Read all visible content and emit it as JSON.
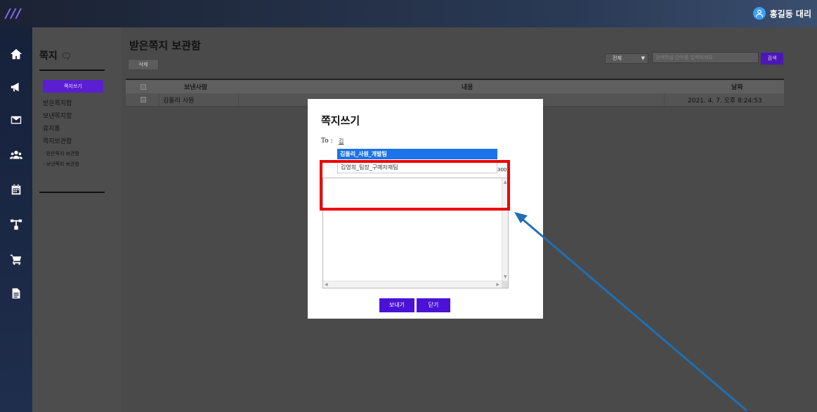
{
  "topbar": {
    "logo": "///",
    "user_name": "홍길동 대리"
  },
  "rail": {
    "icons": [
      "home-icon",
      "megaphone-icon",
      "mail-icon",
      "users-icon",
      "calendar-icon",
      "org-chart-icon",
      "cart-icon",
      "document-icon"
    ]
  },
  "sidebar": {
    "title": "쪽지",
    "title_icon": "chat-bubble-icon",
    "compose_label": "쪽지쓰기",
    "items": [
      {
        "label": "받은쪽지함"
      },
      {
        "label": "보낸쪽지함"
      },
      {
        "label": "휴지통"
      },
      {
        "label": "쪽지보관함"
      }
    ],
    "sub_items": [
      {
        "label": "- 받은쪽지 보관함"
      },
      {
        "label": "- 보낸쪽지 보관함"
      }
    ]
  },
  "main": {
    "title": "받은쪽지 보관함",
    "delete_label": "삭제",
    "filter": {
      "selected": "전체"
    },
    "search": {
      "placeholder": "검색하실 단어를 입력하세요",
      "button": "검색"
    },
    "table": {
      "headers": {
        "sender": "보낸사람",
        "content": "내용",
        "date": "날짜"
      },
      "rows": [
        {
          "sender": "김둘리 사원",
          "content": "",
          "date": "2021. 4. 7. 오후 8:24:53"
        }
      ]
    }
  },
  "modal": {
    "title": "쪽지쓰기",
    "to_label": "To :",
    "to_value": "김",
    "suggestions": [
      "김둘리_사원_개발팀",
      "김영희_팀장_구매자재팀"
    ],
    "counter": "300",
    "send_label": "보내기",
    "close_label": "닫기"
  },
  "colors": {
    "accent": "#4a12d6",
    "highlight": "#1a73e8",
    "annotation_box": "#ee0000",
    "annotation_arrow": "#1f6fb2"
  }
}
